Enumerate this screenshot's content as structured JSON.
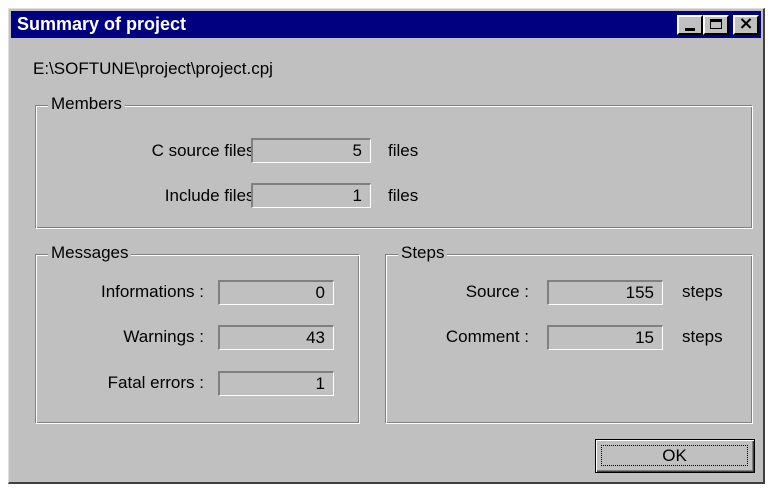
{
  "window": {
    "title": "Summary of project",
    "path": "E:\\SOFTUNE\\project\\project.cpj"
  },
  "titlebar_buttons": [
    "minimize-icon",
    "maximize-icon",
    "close-icon"
  ],
  "colors": {
    "titlebar": "#000080",
    "face": "#c0c0c0"
  },
  "members": {
    "legend": "Members",
    "c_source": {
      "label": "C source files :",
      "value": "5",
      "unit": "files"
    },
    "include": {
      "label": "Include files :",
      "value": "1",
      "unit": "files"
    }
  },
  "messages": {
    "legend": "Messages",
    "informations": {
      "label": "Informations :",
      "value": "0"
    },
    "warnings": {
      "label": "Warnings :",
      "value": "43"
    },
    "fatal": {
      "label": "Fatal errors :",
      "value": "1"
    }
  },
  "steps": {
    "legend": "Steps",
    "source": {
      "label": "Source :",
      "value": "155",
      "unit": "steps"
    },
    "comment": {
      "label": "Comment :",
      "value": "15",
      "unit": "steps"
    }
  },
  "ok_label": "OK"
}
